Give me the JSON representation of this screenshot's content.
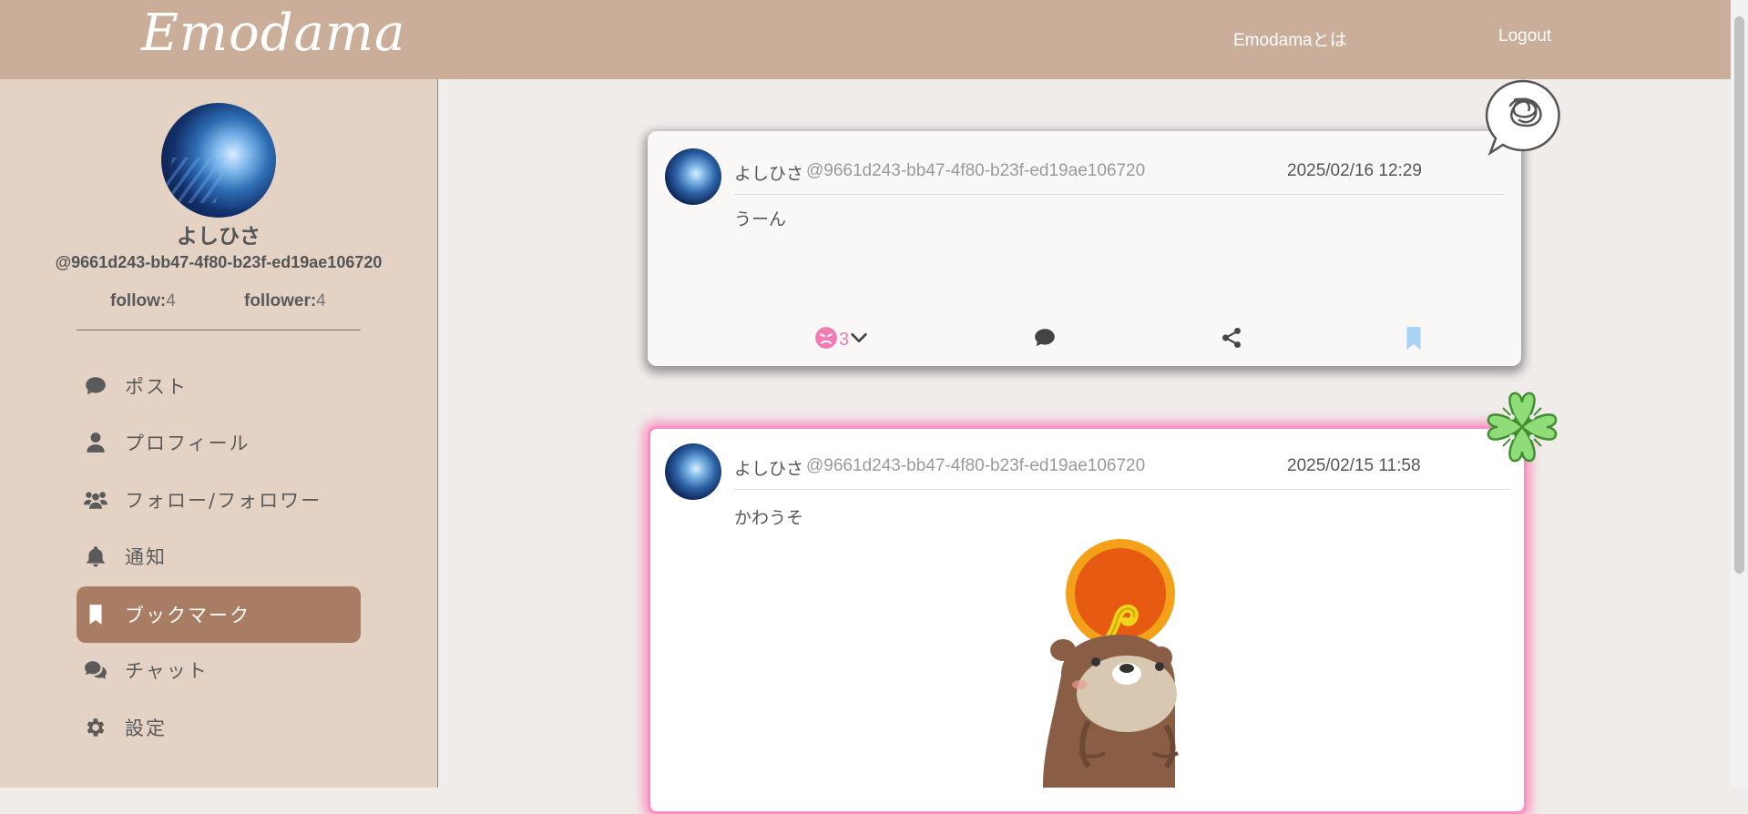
{
  "header": {
    "logo": "Emodama",
    "about_link": "Emodamaとは",
    "logout_link": "Logout"
  },
  "profile": {
    "name": "よしひさ",
    "user_id": "@9661d243-bb47-4f80-b23f-ed19ae106720",
    "follow_label": "follow:",
    "follow_count": "4",
    "follower_label": "follower:",
    "follower_count": "4"
  },
  "menu": [
    {
      "label": "ポスト",
      "icon": "comment-icon",
      "active": false
    },
    {
      "label": "プロフィール",
      "icon": "user-icon",
      "active": false
    },
    {
      "label": "フォロー/フォロワー",
      "icon": "users-icon",
      "active": false
    },
    {
      "label": "通知",
      "icon": "bell-icon",
      "active": false
    },
    {
      "label": "ブックマーク",
      "icon": "bookmark-icon",
      "active": true
    },
    {
      "label": "チャット",
      "icon": "chat-icon",
      "active": false
    },
    {
      "label": "設定",
      "icon": "gear-icon",
      "active": false
    }
  ],
  "posts": [
    {
      "name": "よしひさ",
      "handle": "@9661d243-bb47-4f80-b23f-ed19ae106720",
      "date": "2025/02/16 12:29",
      "text": "うーん",
      "reaction_count": "3",
      "sticker": "scribble-speech-bubble-icon",
      "bookmarked": true
    },
    {
      "name": "よしひさ",
      "handle": "@9661d243-bb47-4f80-b23f-ed19ae106720",
      "date": "2025/02/15 11:58",
      "text": "かわうそ",
      "sticker": "four-leaf-clover-icon",
      "image": "otter-with-snake-and-sun-illustration"
    }
  ],
  "colors": {
    "header_bg": "#cbae99",
    "sidebar_bg": "#e4d3c4",
    "active_menu": "#a97d63",
    "reaction_pink": "#f07cb4",
    "bookmark_blue": "#a9d4f5",
    "highlight_border": "#ff8ec5"
  }
}
